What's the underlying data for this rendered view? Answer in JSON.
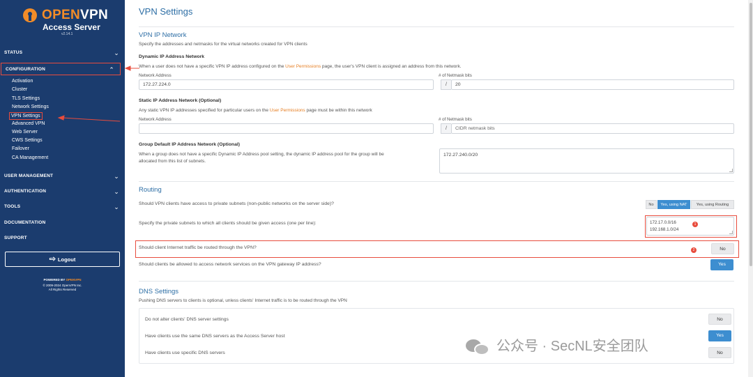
{
  "brand": {
    "name_orange": "OPEN",
    "name_white": "VPN",
    "subtitle": "Access Server",
    "version": "v2.14.1"
  },
  "sidebar": {
    "status": "STATUS",
    "configuration": "CONFIGURATION",
    "config_items": [
      "Activation",
      "Cluster",
      "TLS Settings",
      "Network Settings",
      "VPN Settings",
      "Advanced VPN",
      "Web Server",
      "CWS Settings",
      "Failover",
      "CA Management"
    ],
    "user_management": "USER MANAGEMENT",
    "authentication": "AUTHENTICATION",
    "tools": "TOOLS",
    "documentation": "DOCUMENTATION",
    "support": "SUPPORT",
    "logout": "Logout",
    "powered_by": "POWERED BY",
    "powered_brand": "OPENVPN",
    "copyright": "© 2009-2024 OpenVPN Inc.",
    "rights": "All Rights Reserved"
  },
  "page": {
    "title": "VPN Settings"
  },
  "vpn_ip_network": {
    "title": "VPN IP Network",
    "desc": "Specify the addresses and netmasks for the virtual networks created for VPN clients",
    "dynamic_title": "Dynamic IP Address Network",
    "dynamic_desc_a": "When a user does not have a specific VPN IP address configured on the ",
    "dynamic_desc_link": "User Permissions",
    "dynamic_desc_b": " page, the user's VPN client is assigned an address from this network.",
    "network_address_label": "Network Address",
    "netmask_label": "# of Netmask bits",
    "dynamic_network": "172.27.224.0",
    "dynamic_netmask": "20",
    "static_title": "Static IP Address Network (Optional)",
    "static_desc_a": "Any static VPN IP addresses specified for particular users on the ",
    "static_desc_link": "User Permissions",
    "static_desc_b": " page must be within this network",
    "static_network": "",
    "static_netmask_placeholder": "CIDR netmask bits",
    "slash": "/",
    "group_title": "Group Default IP Address Network (Optional)",
    "group_desc_1": "When a group does not have a specific Dynamic IP Address pool setting, the dynamic IP address pool for the group will be",
    "group_desc_2": "allocated from this list of subnets.",
    "group_value": "172.27.240.0/20"
  },
  "routing": {
    "title": "Routing",
    "q_private_access": "Should VPN clients have access to private subnets (non-public networks on the server side)?",
    "opt_no": "No",
    "opt_nat": "Yes, using NAT",
    "opt_routing": "Yes, using Routing",
    "q_subnets": "Specify the private subnets to which all clients should be given access (one per line):",
    "subnet_1": "172.17.0.0/16",
    "subnet_2": "192.168.1.0/24",
    "badge_1": "1",
    "q_internet": "Should client Internet traffic be routed through the VPN?",
    "internet_value": "No",
    "badge_2": "2",
    "q_gateway": "Should clients be allowed to access network services on the VPN gateway IP address?",
    "gateway_value": "Yes"
  },
  "dns": {
    "title": "DNS Settings",
    "desc": "Pushing DNS servers to clients is optional, unless clients' Internet traffic is to be routed through the VPN",
    "q1": "Do not alter clients' DNS server settings",
    "v1": "No",
    "q2": "Have clients use the same DNS servers as the Access Server host",
    "v2": "Yes",
    "q3": "Have clients use specific DNS servers",
    "v3": "No"
  },
  "watermark": {
    "text": "公众号 · SecNL安全团队"
  },
  "colors": {
    "sidebar_bg": "#1b3c6e",
    "accent_blue": "#3d8ed0",
    "brand_orange": "#f28c28",
    "annotation_red": "#e84c3d"
  }
}
